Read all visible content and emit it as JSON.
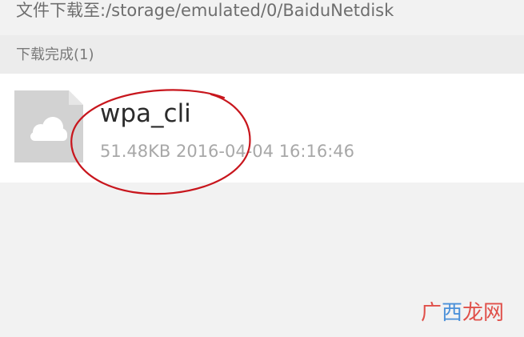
{
  "path_bar": {
    "text": "文件下载至:/storage/emulated/0/BaiduNetdisk"
  },
  "section": {
    "title": "下载完成(1)"
  },
  "files": [
    {
      "name": "wpa_cli",
      "meta": "51.48KB 2016-04-04 16:16:46",
      "icon": "cloud-file-icon"
    }
  ],
  "watermark": {
    "part1": "广",
    "part2": "西",
    "part3": "龙网"
  },
  "colors": {
    "background": "#f2f2f2",
    "row_background": "#ffffff",
    "annotation": "#c8161d",
    "icon_gray": "#d2d2d2"
  }
}
